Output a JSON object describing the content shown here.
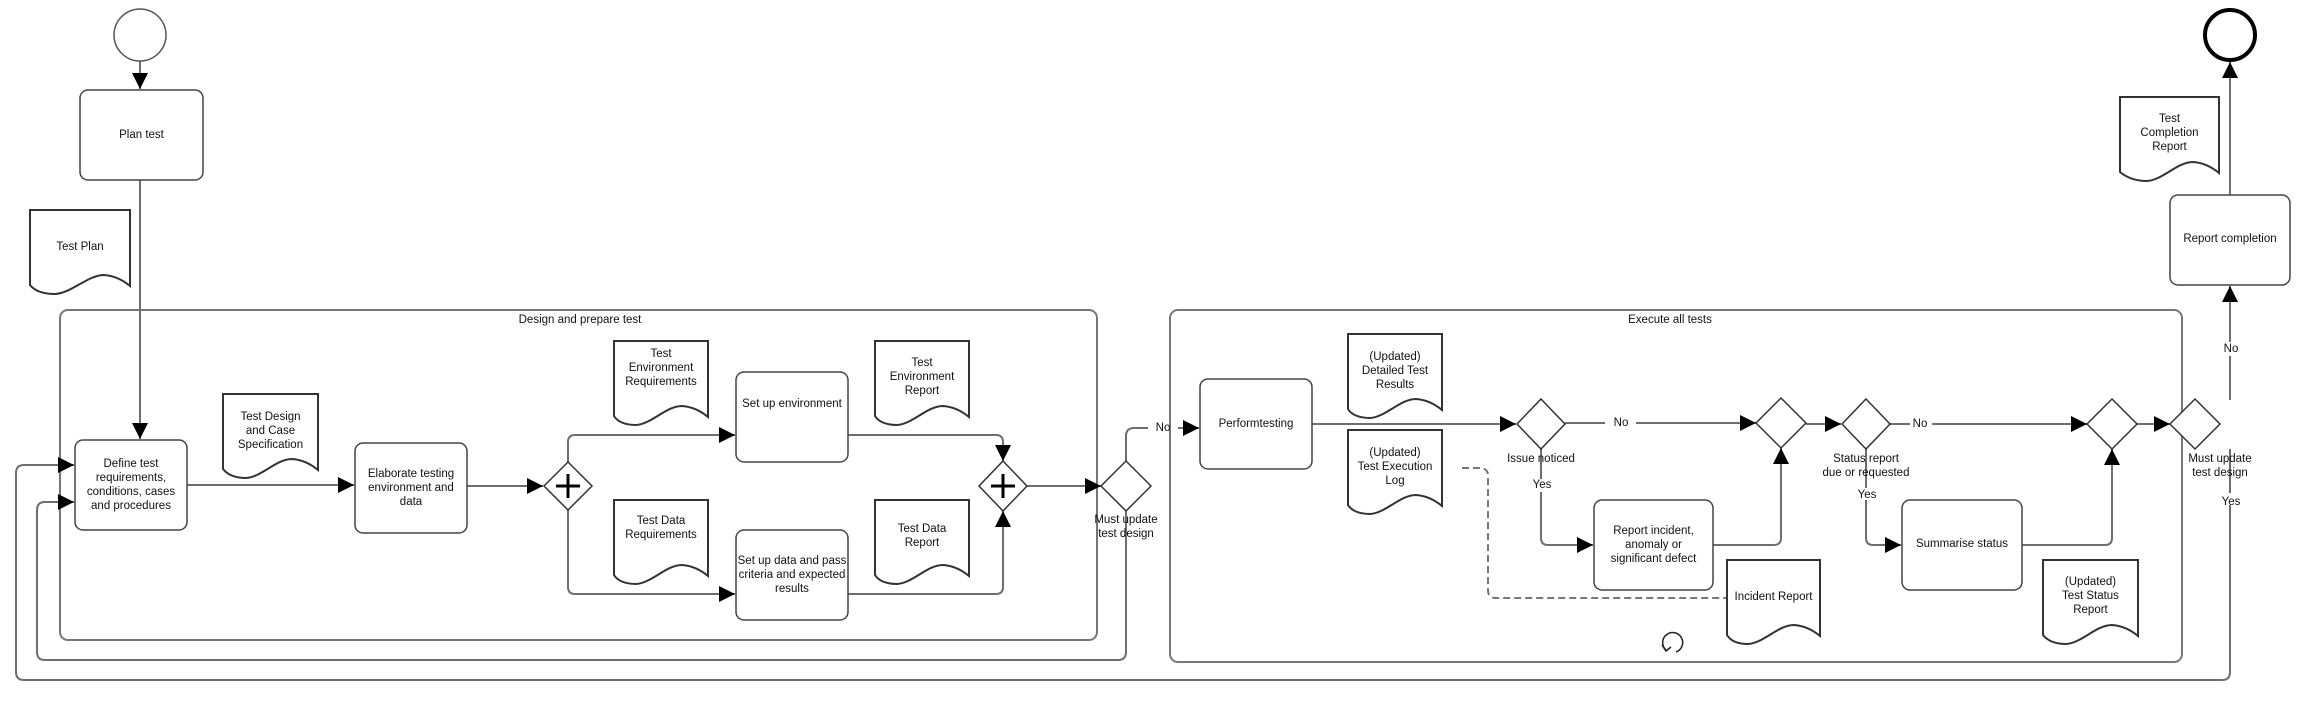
{
  "diagram": {
    "type": "BPMN process",
    "start_event": {
      "label": ""
    },
    "end_event": {
      "label": ""
    },
    "tasks": {
      "plan_test": "Plan test",
      "define": "Define test\nrequirements,\nconditions, cases\nand procedures",
      "elaborate": "Elaborate testing\nenvironment and\ndata",
      "setup_env": "Set up environment",
      "setup_data": "Set up data and pass\ncriteria and expected\nresults",
      "perform": "Performtesting",
      "report_incident": "Report incident,\nanomaly or\nsignificant defect",
      "summarise": "Summarise status",
      "report_completion": "Report completion"
    },
    "documents": {
      "test_plan": "Test Plan",
      "test_design": "Test  Design\nand Case\nSpecification",
      "env_req": "Test\nEnvironment\nRequirements",
      "env_report": "Test\nEnvironment\nReport",
      "data_req": "Test Data\nRequirements",
      "data_report": "Test Data\nReport",
      "detailed_results": "(Updated)\nDetailed Test\nResults",
      "exec_log": "(Updated)\nTest Execution\nLog",
      "incident_report": "Incident Report",
      "status_report": "(Updated)\nTest Status\nReport",
      "completion_report": "Test\nCompletion\nReport"
    },
    "subprocesses": {
      "design": "Design and prepare test",
      "execute": "Execute all tests"
    },
    "gateways": {
      "must_update_1": "Must update\ntest design",
      "issue_noticed": "Issue noticed",
      "status_due": "Status report\ndue or requested",
      "must_update_2": "Must update\ntest design"
    },
    "flow_labels": {
      "no_1": "No",
      "no_issue": "No",
      "yes_issue": "Yes",
      "no_status": "No",
      "yes_status": "Yes",
      "no_2": "No",
      "yes_2": "Yes"
    }
  }
}
